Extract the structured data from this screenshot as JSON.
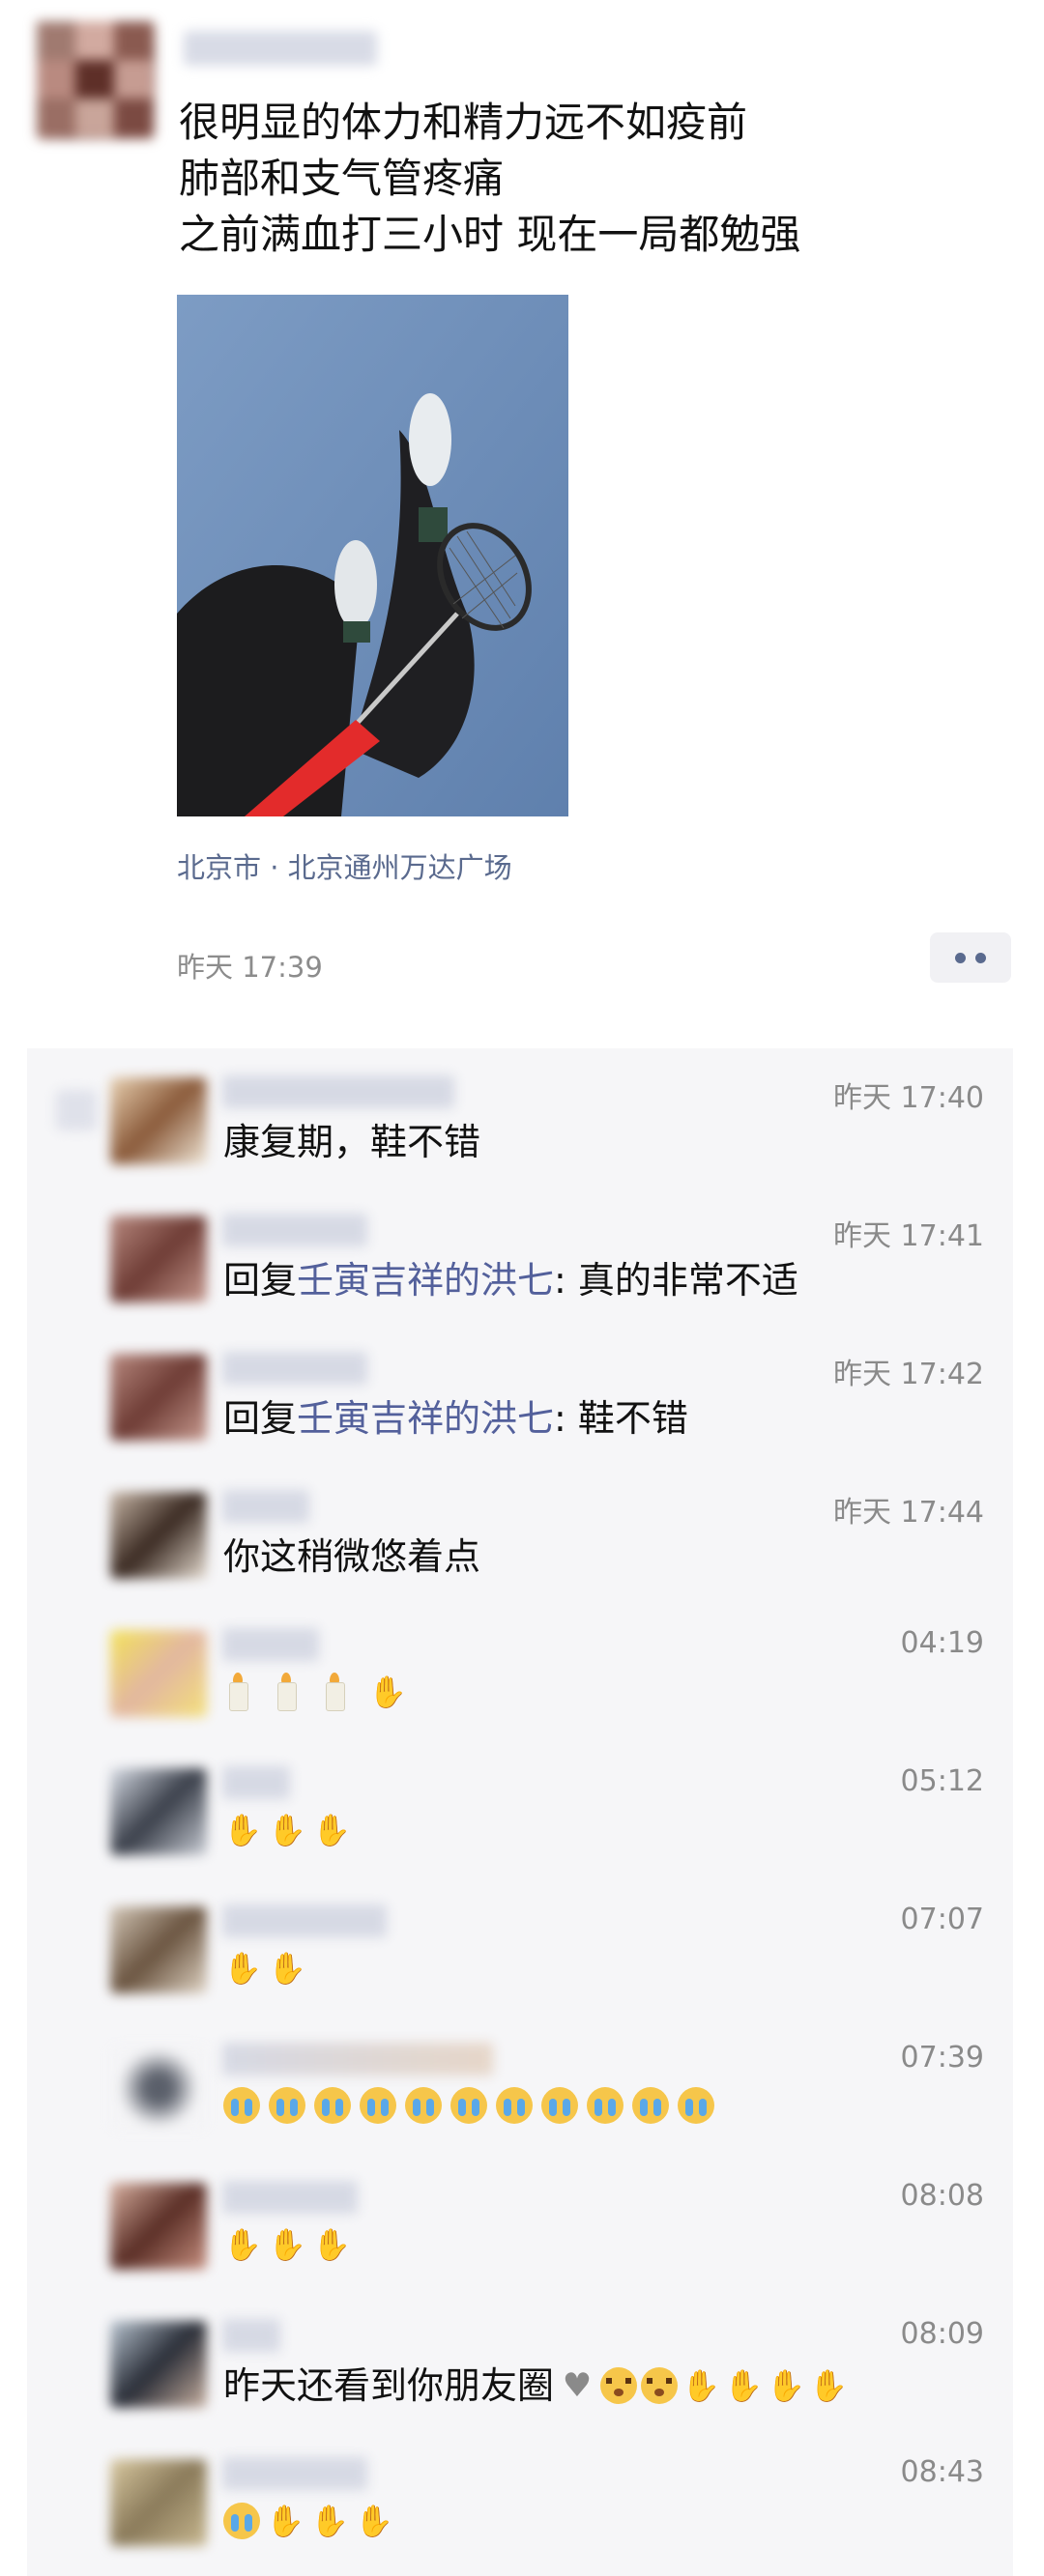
{
  "post": {
    "lines": [
      "很明显的体力和精力远不如疫前",
      "肺部和支气管疼痛",
      "之前满血打三小时 现在一局都勉强"
    ],
    "location": "北京市 · 北京通州万达广场",
    "time": "昨天 17:39"
  },
  "icons": {
    "more": "more-dots-icon",
    "like": "like-icon",
    "candle": "candle-icon",
    "pray": "pray-icon",
    "cry": "crying-face-icon",
    "flushed": "flushed-face-icon",
    "broken_heart": "broken-heart-icon"
  },
  "colors": {
    "link": "#53609b",
    "comment_bg": "#f6f6f8"
  },
  "comments": [
    {
      "time": "昨天 17:40",
      "text": "康复期，鞋不错"
    },
    {
      "time": "昨天 17:41",
      "reply_prefix": "回复",
      "reply_to": "壬寅吉祥的洪七",
      "sep": ": ",
      "text": "真的非常不适"
    },
    {
      "time": "昨天 17:42",
      "reply_prefix": "回复",
      "reply_to": "壬寅吉祥的洪七",
      "sep": ": ",
      "text": "鞋不错"
    },
    {
      "time": "昨天 17:44",
      "text": "你这稍微悠着点"
    },
    {
      "time": "04:19"
    },
    {
      "time": "05:12"
    },
    {
      "time": "07:07"
    },
    {
      "time": "07:39"
    },
    {
      "time": "08:08"
    },
    {
      "time": "08:09",
      "text": "昨天还看到你朋友圈"
    },
    {
      "time": "08:43"
    }
  ]
}
